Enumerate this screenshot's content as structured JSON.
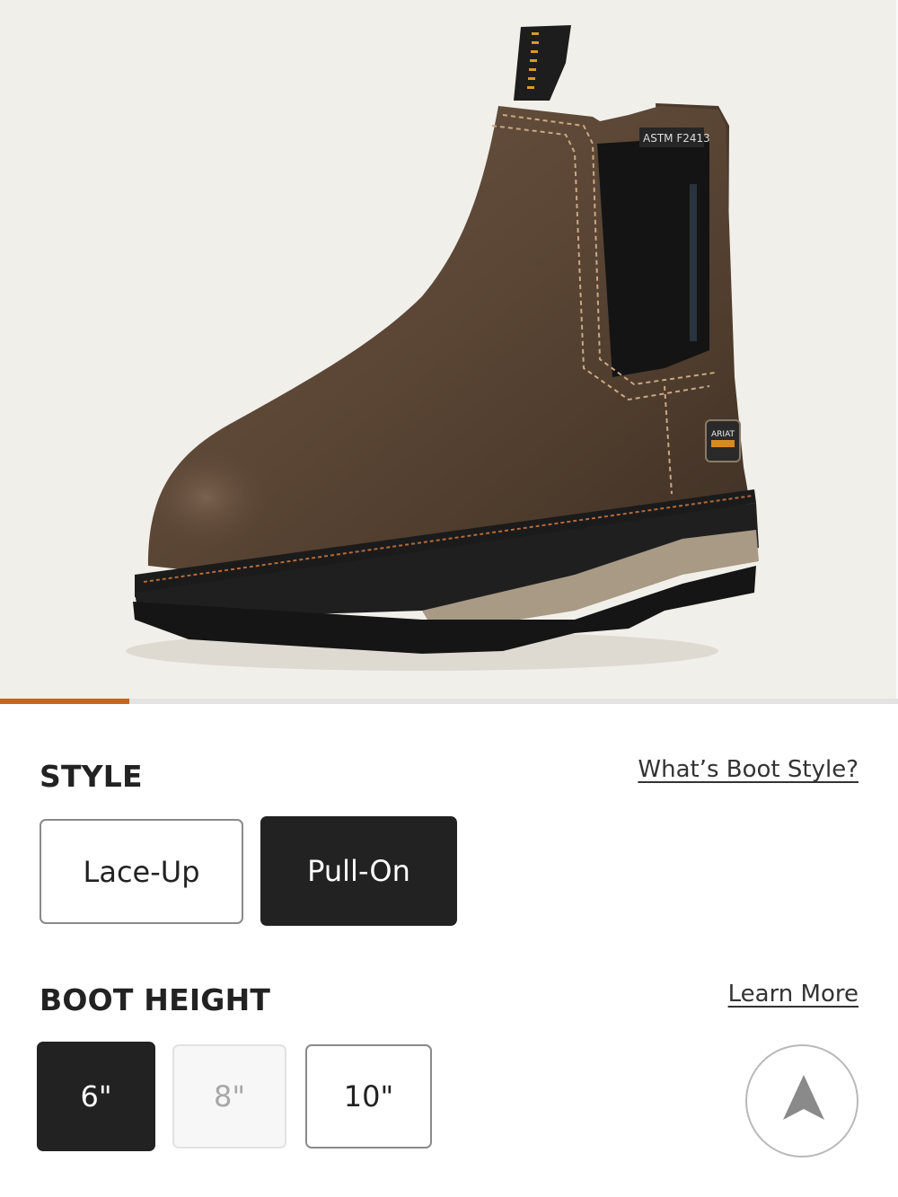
{
  "product": {
    "image_alt": "Brown leather pull-on work boot",
    "image_progress_fraction": 0.144
  },
  "style": {
    "title": "STYLE",
    "help_link": "What’s Boot Style?",
    "options": [
      {
        "label": "Lace-Up",
        "state": "available"
      },
      {
        "label": "Pull-On",
        "state": "selected"
      }
    ]
  },
  "boot_height": {
    "title": "BOOT HEIGHT",
    "help_link": "Learn More",
    "options": [
      {
        "label": "6\"",
        "state": "selected"
      },
      {
        "label": "8\"",
        "state": "unavailable"
      },
      {
        "label": "10\"",
        "state": "available"
      }
    ]
  },
  "actions": {
    "scroll_top_icon": "arrow-up-icon"
  },
  "colors": {
    "accent": "#c4661e",
    "selected_bg": "#222222",
    "hero_bg": "#f1efea"
  }
}
